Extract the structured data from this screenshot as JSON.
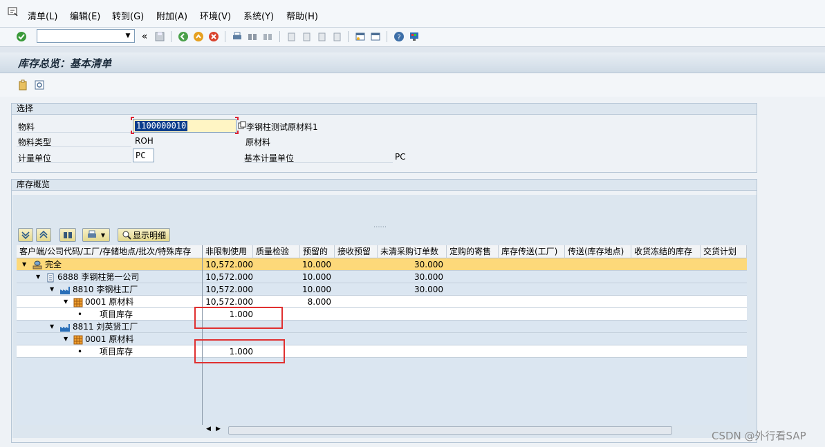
{
  "menu": {
    "items": [
      "清单(L)",
      "编辑(E)",
      "转到(G)",
      "附加(A)",
      "环境(V)",
      "系统(Y)",
      "帮助(H)"
    ]
  },
  "toolbar": {
    "command_field_value": "",
    "icons": [
      "enter-icon",
      "save-icon",
      "back-icon",
      "exit-icon",
      "cancel-icon",
      "print-icon",
      "find-icon",
      "find-next-icon",
      "first-page-icon",
      "previous-page-icon",
      "next-page-icon",
      "last-page-icon",
      "create-session-icon",
      "shortcut-icon",
      "help-icon",
      "customize-layout-icon"
    ]
  },
  "title": "库存总览：基本清单",
  "selection": {
    "group_title": "选择",
    "material_label": "物料",
    "material_value": "1100000010",
    "material_desc": "李钢柱测试原材料1",
    "material_type_label": "物料类型",
    "material_type_value": "ROH",
    "material_type_desc": "原材料",
    "uom_label": "计量单位",
    "uom_value": "PC",
    "base_uom_label": "基本计量单位",
    "base_uom_value": "PC"
  },
  "overview": {
    "group_title": "库存概览",
    "detail_button": "显示明细",
    "columns": [
      "客户端/公司代码/工厂/存储地点/批次/特殊库存",
      "非限制使用",
      "质量检验",
      "预留的",
      "接收预留",
      "未清采购订单数",
      "定购的寄售",
      "库存传送(工厂)",
      "传送(库存地点)",
      "收货冻结的库存",
      "交货计划"
    ],
    "rows": [
      {
        "label": "完全",
        "unrestricted": "10,572.000",
        "reserved": "10.000",
        "open_po": "30.000"
      },
      {
        "label": "6888 李钢柱第一公司",
        "unrestricted": "10,572.000",
        "reserved": "10.000",
        "open_po": "30.000"
      },
      {
        "label": "8810 李钢柱工厂",
        "unrestricted": "10,572.000",
        "reserved": "10.000",
        "open_po": "30.000"
      },
      {
        "label": "0001 原材料",
        "unrestricted": "10,572.000",
        "reserved": "8.000",
        "open_po": ""
      },
      {
        "label": "项目库存",
        "unrestricted": "1.000",
        "reserved": "",
        "open_po": ""
      },
      {
        "label": "8811 刘英贤工厂",
        "unrestricted": "",
        "reserved": "",
        "open_po": ""
      },
      {
        "label": "0001 原材料",
        "unrestricted": "",
        "reserved": "",
        "open_po": ""
      },
      {
        "label": "项目库存",
        "unrestricted": "1.000",
        "reserved": "",
        "open_po": ""
      }
    ]
  },
  "watermark": "CSDN @外行看SAP",
  "colors": {
    "total_row": "#fdd97a",
    "highlight_box": "#e03030",
    "selection_fill": "#0b3d8c"
  }
}
